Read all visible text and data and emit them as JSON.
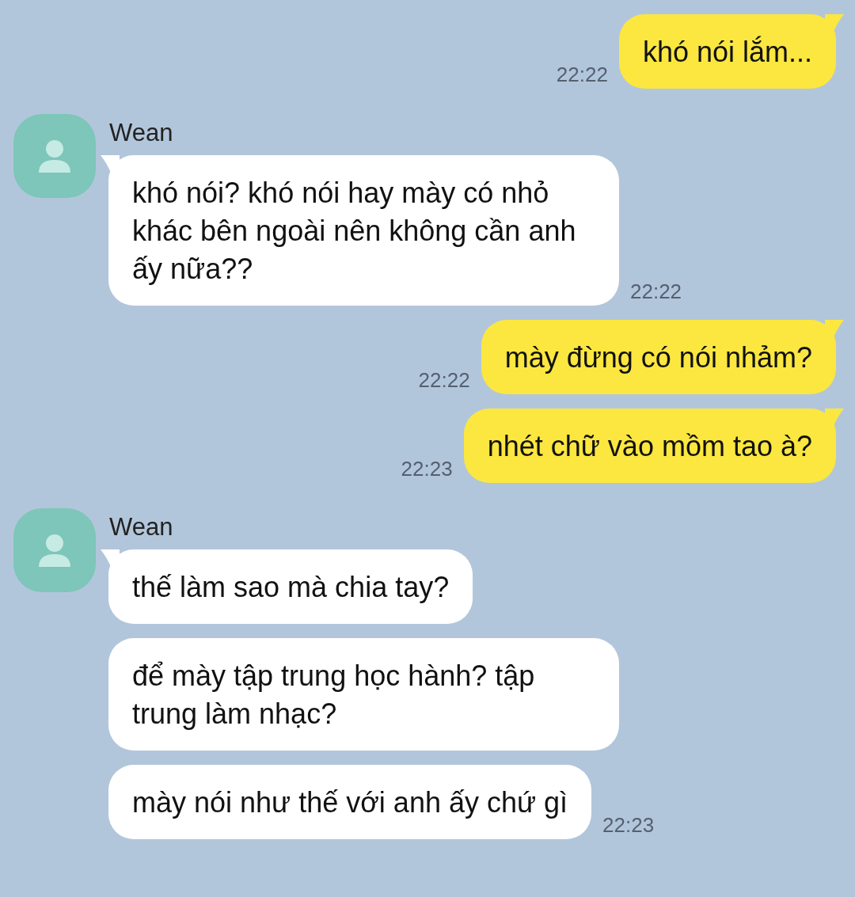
{
  "messages": [
    {
      "kind": "outgoing",
      "text": "khó nói lắm...",
      "time": "22:22"
    },
    {
      "kind": "incoming",
      "sender": "Wean",
      "text": "khó nói? khó nói hay mày có nhỏ khác bên ngoài nên không cần anh ấy nữa??",
      "time": "22:22"
    },
    {
      "kind": "outgoing",
      "text": "mày đừng có nói nhảm?",
      "time": "22:22"
    },
    {
      "kind": "outgoing",
      "text": "nhét chữ vào mồm tao à?",
      "time": "22:23"
    },
    {
      "kind": "incoming",
      "sender": "Wean",
      "text": "thế làm sao mà chia tay?"
    },
    {
      "kind": "incoming",
      "text": "để mày tập trung học hành? tập trung làm nhạc?"
    },
    {
      "kind": "incoming",
      "text": "mày nói như thế với anh ấy chứ gì",
      "time": "22:23"
    }
  ]
}
